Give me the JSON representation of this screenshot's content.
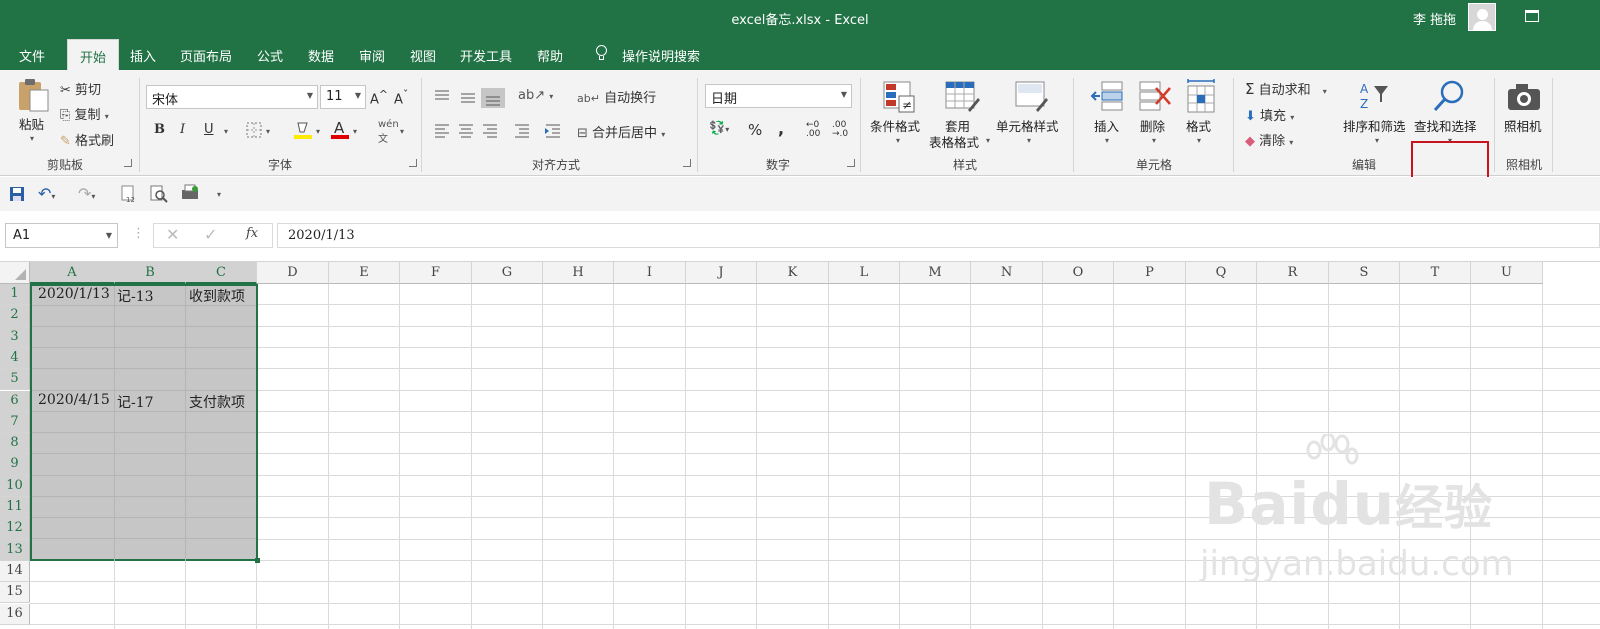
{
  "window": {
    "title": "excel备忘.xlsx  -  Excel",
    "user": "李 拖拖"
  },
  "tabs": [
    "文件",
    "开始",
    "插入",
    "页面布局",
    "公式",
    "数据",
    "审阅",
    "视图",
    "开发工具",
    "帮助"
  ],
  "tell_me": "操作说明搜索",
  "ribbon": {
    "clipboard": {
      "paste": "粘贴",
      "cut": "剪切",
      "copy": "复制",
      "format_painter": "格式刷",
      "group": "剪贴板"
    },
    "font": {
      "name": "宋体",
      "size": "11",
      "bold": "B",
      "italic": "I",
      "underline": "U",
      "group": "字体"
    },
    "alignment": {
      "wrap": "自动换行",
      "merge": "合并后居中",
      "group": "对齐方式"
    },
    "number": {
      "format": "日期",
      "group": "数字"
    },
    "styles": {
      "conditional": "条件格式",
      "table1": "套用",
      "table2": "表格格式",
      "cell_styles": "单元格样式",
      "group": "样式"
    },
    "cells": {
      "insert": "插入",
      "delete": "删除",
      "format": "格式",
      "group": "单元格"
    },
    "editing": {
      "autosum": "自动求和",
      "fill": "填充",
      "clear": "清除",
      "sort": "排序和筛选",
      "find": "查找和选择",
      "group": "编辑"
    },
    "camera": {
      "label": "照相机",
      "group": "照相机"
    }
  },
  "formula_bar": {
    "name_box": "A1",
    "fx": "fx",
    "value": "2020/1/13"
  },
  "columns": [
    "A",
    "B",
    "C",
    "D",
    "E",
    "F",
    "G",
    "H",
    "I",
    "J",
    "K",
    "L",
    "M",
    "N",
    "O",
    "P",
    "Q",
    "R",
    "S",
    "T",
    "U"
  ],
  "rows": [
    "1",
    "2",
    "3",
    "4",
    "5",
    "6",
    "7",
    "8",
    "9",
    "10",
    "11",
    "12",
    "13",
    "14",
    "15",
    "16"
  ],
  "cells": {
    "A1": "2020/1/13",
    "B1": "记-13",
    "C1": "收到款项",
    "A6": "2020/4/15",
    "B6": "记-17",
    "C6": "支付款项"
  },
  "watermark": {
    "brand": "Baidu",
    "product": "经验",
    "url": "jingyan.baidu.com"
  }
}
